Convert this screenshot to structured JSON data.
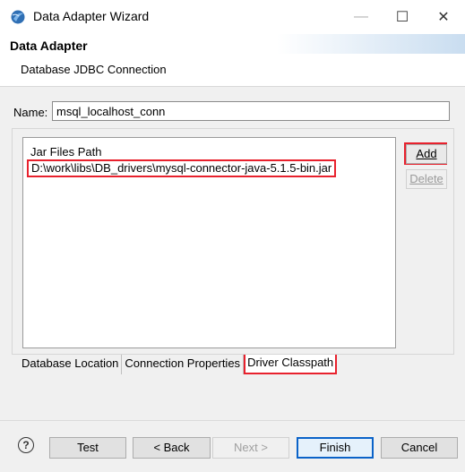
{
  "window": {
    "title": "Data Adapter Wizard",
    "minimize_glyph": "—",
    "maximize_glyph": "☐",
    "close_glyph": "✕"
  },
  "header": {
    "title": "Data Adapter",
    "description": "Database JDBC Connection"
  },
  "name_field": {
    "label": "Name:",
    "value": "msql_localhost_conn"
  },
  "jar_list": {
    "header": "Jar Files Path",
    "rows": [
      "D:\\work\\libs\\DB_drivers\\mysql-connector-java-5.1.5-bin.jar"
    ]
  },
  "side_buttons": {
    "add": "Add",
    "delete": "Delete"
  },
  "tabs": [
    {
      "label": "Database Location",
      "active": false
    },
    {
      "label": "Connection Properties",
      "active": false
    },
    {
      "label": "Driver Classpath",
      "active": true
    }
  ],
  "footer": {
    "help_glyph": "?",
    "test": "Test",
    "back": "< Back",
    "next": "Next >",
    "finish": "Finish",
    "cancel": "Cancel"
  },
  "colors": {
    "highlight": "#e8212d",
    "accent": "#0a62c8"
  }
}
